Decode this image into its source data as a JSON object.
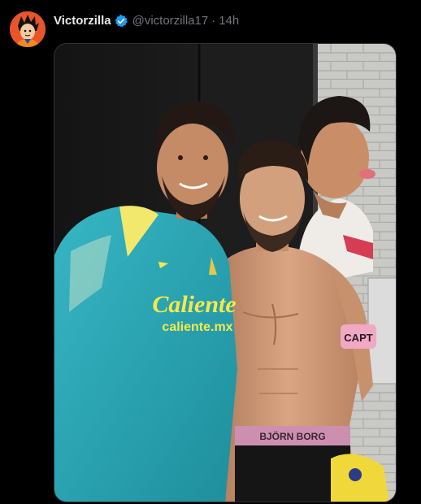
{
  "author": {
    "display_name": "Victorzilla",
    "handle": "@victorzilla17",
    "separator": "·",
    "timestamp": "14h",
    "verified": true
  },
  "photo": {
    "shirt_brand_line1": "Caliente",
    "shirt_brand_line2": "caliente.mx",
    "waistband_text": "BJÖRN BORG",
    "armband_text": "CAPT"
  },
  "colors": {
    "background": "#000000",
    "name": "#e7e9ea",
    "muted": "#71767b",
    "verified": "#1d9bf0",
    "jersey": "#2aa8b8",
    "jersey_accent": "#f5e94a"
  }
}
